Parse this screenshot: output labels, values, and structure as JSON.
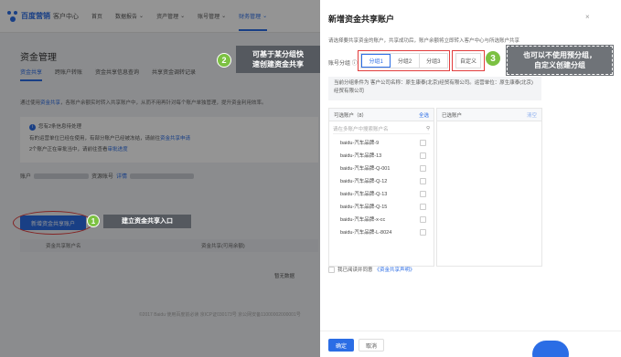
{
  "top_nav": {
    "brand_name": "百度营销",
    "brand_sub": "客户中心",
    "items": [
      {
        "label": "首页"
      },
      {
        "label": "数据报告",
        "dropdown": true
      },
      {
        "label": "资产管理",
        "dropdown": true
      },
      {
        "label": "账号管理",
        "dropdown": true
      },
      {
        "label": "财务管理",
        "dropdown": true,
        "active": true
      }
    ]
  },
  "background": {
    "section_title": "资金管理",
    "subtabs": [
      "资金共享",
      "跨账户转账",
      "资金共享信息查询",
      "共享资金调转记录"
    ],
    "info_prefix": "通过使用",
    "info_link": "资金共享",
    "info_suffix": "，各账户余额实时转入共享账户中，从而不用再针对每个账户单独管理，提升资金利用效率。",
    "notice_title": "您有2条信息待处理",
    "notice_line1_prefix": "有的运营单位已经在使用，有部分账户已经被冻结，请前往",
    "notice_line1_link": "资金共享申请",
    "notice_line2_prefix": "2个账户正在审批当中，请前往查看",
    "notice_line2_link": "审批进度",
    "account_label": "账户",
    "account_mid": "资源账号",
    "account_link": "详情",
    "create_button": "新增资金共享账户",
    "table_col1": "资金共享账户名",
    "table_col2": "资金共享(可用余额)",
    "empty_cell": "暂无数据",
    "footer": "©2017 Baidu 使用百度前必读 京ICP证030173号 京公网安备11000002000001号"
  },
  "drawer": {
    "title": "新增资金共享账户",
    "close_icon": "close-icon",
    "desc": "请选择要共享资金的账户，共享成功后，账户余额将立即转入客户中心与所选账户共享",
    "group_label": "账号分组",
    "group_tabs": [
      "分组1",
      "分组2",
      "分组3"
    ],
    "custom_button": "自定义",
    "condition_text": "当前分组条件为 客户公司名称：原生康泰(北京)经贸有限公司。运营单位：原生康泰(北京)经贸有限公司",
    "left_panel": {
      "header": "可选账户（8）",
      "select_all": "全选",
      "search_placeholder": "请在多账户中搜索账户名",
      "accounts": [
        "baidu-汽车品牌-9",
        "baidu-汽车品牌-13",
        "baidu-汽车品牌-Q-001",
        "baidu-汽车品牌-Q-12",
        "baidu-汽车品牌-Q-13",
        "baidu-汽车品牌-Q-15",
        "baidu-汽车品牌-x-cc",
        "baidu-汽车品牌-L-8024"
      ]
    },
    "right_panel": {
      "header": "已选账户",
      "clear": "清空"
    },
    "agree_text": "我已阅读并同意",
    "agree_link": "《资金共享声明》",
    "ok_button": "确定",
    "cancel_button": "取消"
  },
  "callouts": {
    "step1": {
      "num": "1",
      "text": "建立资金共享入口"
    },
    "step2": {
      "num": "2",
      "line1": "可基于某分组快",
      "line2": "速创建资金共享"
    },
    "step3": {
      "num": "3",
      "line1": "也可以不使用预分组，",
      "line2": "自定义创建分组"
    }
  },
  "colors": {
    "brand_blue": "#2b6de5",
    "step_green": "#7cc142",
    "highlight_red": "#e23d3d"
  }
}
